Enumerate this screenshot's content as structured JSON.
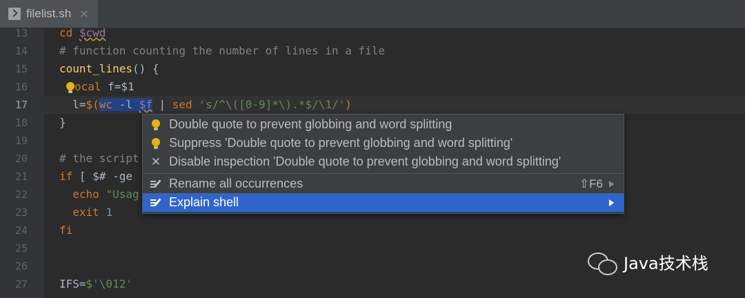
{
  "tab": {
    "title": "filelist.sh",
    "close": "✕"
  },
  "editor": {
    "lines": [
      {
        "num": "13"
      },
      {
        "num": "14"
      },
      {
        "num": "15"
      },
      {
        "num": "16"
      },
      {
        "num": "17"
      },
      {
        "num": "18"
      },
      {
        "num": "19"
      },
      {
        "num": "20"
      },
      {
        "num": "21"
      },
      {
        "num": "22"
      },
      {
        "num": "23"
      },
      {
        "num": "24"
      },
      {
        "num": "25"
      },
      {
        "num": "26"
      },
      {
        "num": "27"
      }
    ],
    "code": {
      "l13_kw": "cd ",
      "l13_var": "$cwd",
      "l14": "# function counting the number of lines in a file",
      "l15_fn": "count_lines",
      "l15_rest": "() {",
      "l16_kw": "ocal",
      "l16_rest": " f=$1",
      "l17_a": "  l=",
      "l17_b": "$(",
      "l17_c": "wc",
      "l17_d": " -l ",
      "l17_e": "$f",
      "l17_f": " | ",
      "l17_g": "sed",
      "l17_h": " ",
      "l17_i": "'s/^\\([0-9]*\\).*$/\\1/'",
      "l17_j": ")",
      "l18": "}",
      "l20": "# the script",
      "l21_kw": "if",
      "l21_rest": " [ $# -ge",
      "l22_kw": "  echo ",
      "l22_str": "\"Usag",
      "l23_kw": "  exit ",
      "l23_num": "1",
      "l24": "fi",
      "l27_a": "IFS=",
      "l27_b": "$'\\012'"
    }
  },
  "popup": {
    "items": [
      {
        "label": "Double quote to prevent globbing and word splitting",
        "icon": "lightbulb-icon"
      },
      {
        "label": "Suppress 'Double quote to prevent globbing and word splitting'",
        "icon": "lightbulb-icon"
      },
      {
        "label": "Disable inspection 'Double quote to prevent globbing and word splitting'",
        "icon": "close-icon"
      },
      {
        "label": "Rename all occurrences",
        "shortcut": "⇧F6",
        "icon": "edit-icon"
      },
      {
        "label": "Explain shell",
        "icon": "edit-icon"
      }
    ]
  },
  "watermark": {
    "text": "Java技术栈"
  },
  "colors": {
    "accent": "#2f65ca",
    "background": "#2b2b2b",
    "keyword": "#cc7832",
    "comment": "#808080",
    "string": "#6a8759"
  }
}
